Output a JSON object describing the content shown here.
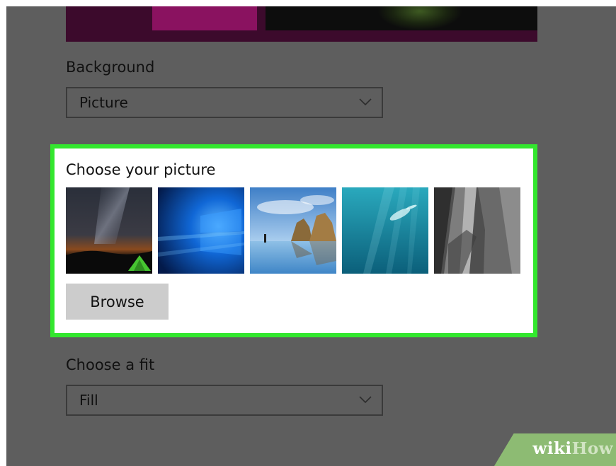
{
  "background_section": {
    "label": "Background",
    "selected": "Picture"
  },
  "picture_section": {
    "title": "Choose your picture",
    "thumbnails": [
      {
        "icon": "night-sky-tent-thumbnail"
      },
      {
        "icon": "windows-blue-logo-thumbnail"
      },
      {
        "icon": "beach-rocks-thumbnail"
      },
      {
        "icon": "underwater-swimmer-thumbnail"
      },
      {
        "icon": "rock-cliff-thumbnail"
      }
    ],
    "browse_label": "Browse"
  },
  "fit_section": {
    "label": "Choose a fit",
    "selected": "Fill"
  },
  "watermark": {
    "part1": "wiki",
    "part2": "How"
  },
  "colors": {
    "highlight_border": "#33e72e",
    "panel_bg": "#5e5e5e",
    "button_bg": "#cccccc"
  }
}
